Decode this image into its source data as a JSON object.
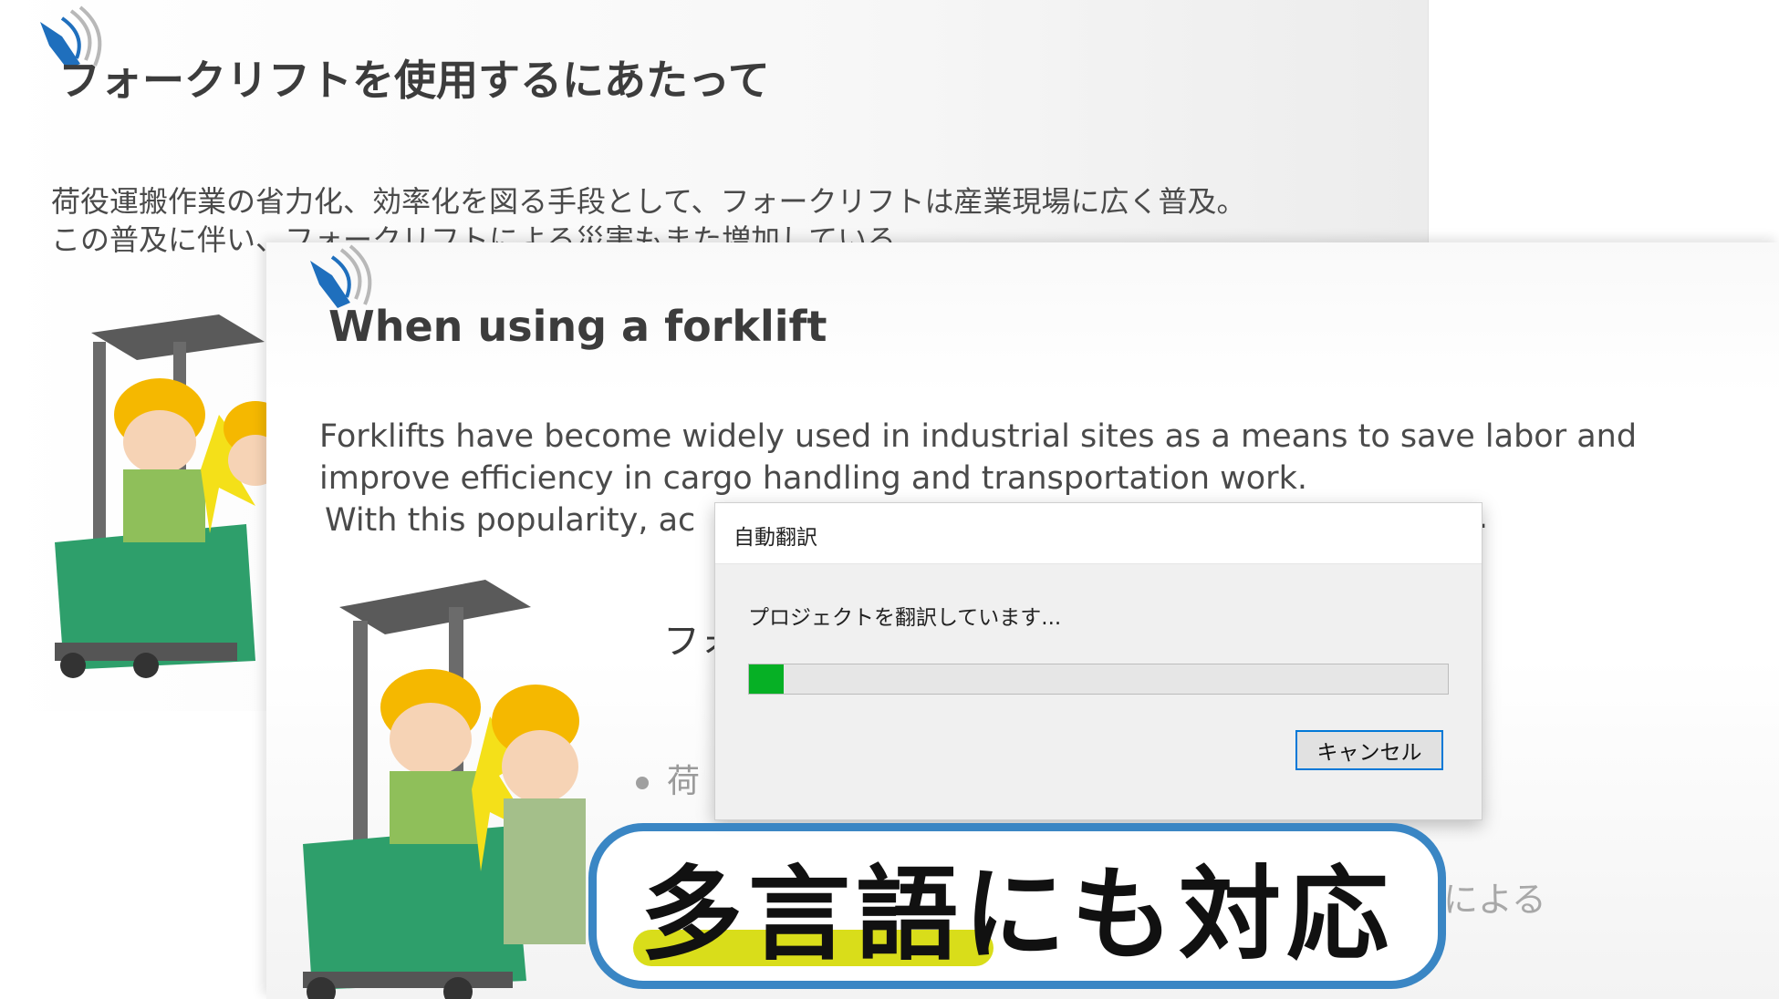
{
  "slide_back": {
    "title": "フォークリフトを使用するにあたって",
    "body_lines": [
      "荷役運搬作業の省力化、効率化を図る手段として、フォークリフトは産業現場に広く普及。",
      "この普及に伴い、フォークリフトによる災害もまた増加している。"
    ]
  },
  "slide_front": {
    "title": "When using a forklift",
    "body_lines": [
      "Forklifts have become widely used in industrial sites as a means to save labor and",
      "improve efficiency in cargo handling and transportation work.",
      "With this popularity, ac"
    ],
    "trailing_period": ".",
    "subheading_fragment": "フォ",
    "bullet_fragment": "荷",
    "trailing_fragment": "による"
  },
  "dialog": {
    "title": "自動翻訳",
    "status": "プロジェクトを翻訳しています...",
    "progress": 0.05,
    "cancel_label": "キャンセル"
  },
  "caption": {
    "text": "多言語にも対応"
  },
  "colors": {
    "progress_green": "#06b025",
    "caption_border": "#3a86c4",
    "caption_highlight": "#d9dd1a",
    "button_focus": "#0078d7"
  },
  "icons": [
    "speaker-logo-icon",
    "forklift-accident-illustration"
  ]
}
